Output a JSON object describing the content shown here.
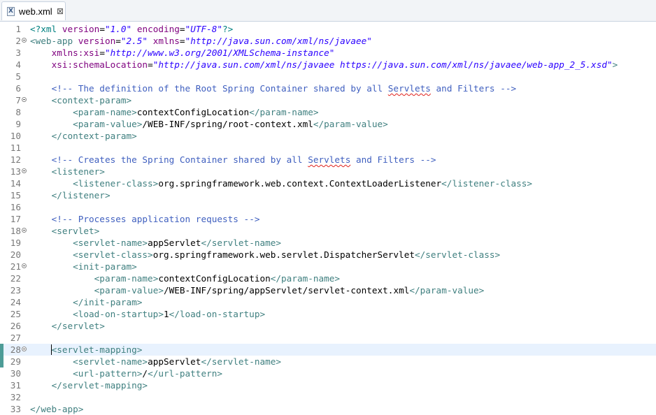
{
  "tab": {
    "label": "web.xml",
    "icon": "xml-file-icon",
    "close": "⊠"
  },
  "editor": {
    "current_line": 28,
    "fold_lines": [
      2,
      7,
      13,
      18,
      21,
      28
    ],
    "change_lines": [
      28,
      29
    ],
    "lines": [
      [
        [
          "pi",
          "<?xml "
        ],
        [
          "attr",
          "version"
        ],
        [
          "text",
          "="
        ],
        [
          "str",
          "\"1.0\""
        ],
        [
          "text",
          " "
        ],
        [
          "attr",
          "encoding"
        ],
        [
          "text",
          "="
        ],
        [
          "str",
          "\"UTF-8\""
        ],
        [
          "pi",
          "?>"
        ]
      ],
      [
        [
          "tag",
          "<web-app "
        ],
        [
          "attr",
          "version"
        ],
        [
          "text",
          "="
        ],
        [
          "str",
          "\"2.5\""
        ],
        [
          "text",
          " "
        ],
        [
          "attr",
          "xmlns"
        ],
        [
          "text",
          "="
        ],
        [
          "str",
          "\"http://java.sun.com/xml/ns/javaee\""
        ]
      ],
      [
        [
          "text",
          "    "
        ],
        [
          "attr",
          "xmlns:xsi"
        ],
        [
          "text",
          "="
        ],
        [
          "str",
          "\"http://www.w3.org/2001/XMLSchema-instance\""
        ]
      ],
      [
        [
          "text",
          "    "
        ],
        [
          "attr",
          "xsi:schemaLocation"
        ],
        [
          "text",
          "="
        ],
        [
          "str",
          "\"http://java.sun.com/xml/ns/javaee https://java.sun.com/xml/ns/javaee/web-app_2_5.xsd\""
        ],
        [
          "tag",
          ">"
        ]
      ],
      [],
      [
        [
          "text",
          "    "
        ],
        [
          "cmt",
          "<!-- The definition of the Root Spring Container shared by all "
        ],
        [
          "cmt-spell",
          "Servlets"
        ],
        [
          "cmt",
          " and Filters -->"
        ]
      ],
      [
        [
          "text",
          "    "
        ],
        [
          "tag",
          "<context-param>"
        ]
      ],
      [
        [
          "text",
          "        "
        ],
        [
          "tag",
          "<param-name>"
        ],
        [
          "text",
          "contextConfigLocation"
        ],
        [
          "tag",
          "</param-name>"
        ]
      ],
      [
        [
          "text",
          "        "
        ],
        [
          "tag",
          "<param-value>"
        ],
        [
          "text",
          "/WEB-INF/spring/root-context.xml"
        ],
        [
          "tag",
          "</param-value>"
        ]
      ],
      [
        [
          "text",
          "    "
        ],
        [
          "tag",
          "</context-param>"
        ]
      ],
      [],
      [
        [
          "text",
          "    "
        ],
        [
          "cmt",
          "<!-- Creates the Spring Container shared by all "
        ],
        [
          "cmt-spell",
          "Servlets"
        ],
        [
          "cmt",
          " and Filters -->"
        ]
      ],
      [
        [
          "text",
          "    "
        ],
        [
          "tag",
          "<listener>"
        ]
      ],
      [
        [
          "text",
          "        "
        ],
        [
          "tag",
          "<listener-class>"
        ],
        [
          "text",
          "org.springframework.web.context.ContextLoaderListener"
        ],
        [
          "tag",
          "</listener-class>"
        ]
      ],
      [
        [
          "text",
          "    "
        ],
        [
          "tag",
          "</listener>"
        ]
      ],
      [],
      [
        [
          "text",
          "    "
        ],
        [
          "cmt",
          "<!-- Processes application requests -->"
        ]
      ],
      [
        [
          "text",
          "    "
        ],
        [
          "tag",
          "<servlet>"
        ]
      ],
      [
        [
          "text",
          "        "
        ],
        [
          "tag",
          "<servlet-name>"
        ],
        [
          "text",
          "appServlet"
        ],
        [
          "tag",
          "</servlet-name>"
        ]
      ],
      [
        [
          "text",
          "        "
        ],
        [
          "tag",
          "<servlet-class>"
        ],
        [
          "text",
          "org.springframework.web.servlet.DispatcherServlet"
        ],
        [
          "tag",
          "</servlet-class>"
        ]
      ],
      [
        [
          "text",
          "        "
        ],
        [
          "tag",
          "<init-param>"
        ]
      ],
      [
        [
          "text",
          "            "
        ],
        [
          "tag",
          "<param-name>"
        ],
        [
          "text",
          "contextConfigLocation"
        ],
        [
          "tag",
          "</param-name>"
        ]
      ],
      [
        [
          "text",
          "            "
        ],
        [
          "tag",
          "<param-value>"
        ],
        [
          "text",
          "/WEB-INF/spring/appServlet/servlet-context.xml"
        ],
        [
          "tag",
          "</param-value>"
        ]
      ],
      [
        [
          "text",
          "        "
        ],
        [
          "tag",
          "</init-param>"
        ]
      ],
      [
        [
          "text",
          "        "
        ],
        [
          "tag",
          "<load-on-startup>"
        ],
        [
          "text",
          "1"
        ],
        [
          "tag",
          "</load-on-startup>"
        ]
      ],
      [
        [
          "text",
          "    "
        ],
        [
          "tag",
          "</servlet>"
        ]
      ],
      [],
      [
        [
          "text",
          "    "
        ],
        [
          "tag",
          "<servlet-mapping>"
        ]
      ],
      [
        [
          "text",
          "        "
        ],
        [
          "tag",
          "<servlet-name>"
        ],
        [
          "text",
          "appServlet"
        ],
        [
          "tag",
          "</servlet-name>"
        ]
      ],
      [
        [
          "text",
          "        "
        ],
        [
          "tag",
          "<url-pattern>"
        ],
        [
          "text",
          "/"
        ],
        [
          "tag",
          "</url-pattern>"
        ]
      ],
      [
        [
          "text",
          "    "
        ],
        [
          "tag",
          "</servlet-mapping>"
        ]
      ],
      [],
      [
        [
          "tag",
          "</web-app>"
        ]
      ]
    ]
  }
}
